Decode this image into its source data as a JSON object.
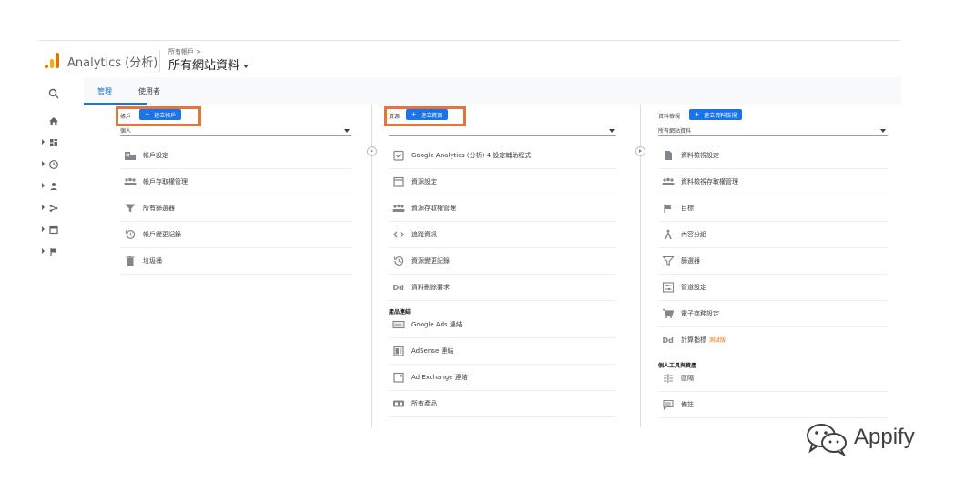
{
  "header": {
    "app_title": "Analytics (分析)",
    "breadcrumb": "所有帳戶 >",
    "view_title": "所有網站資料"
  },
  "tabs": [
    {
      "label": "管理",
      "active": true
    },
    {
      "label": "使用者",
      "active": false
    }
  ],
  "rail": {
    "icons": [
      "search-icon",
      "home-icon",
      "dashboard-icon",
      "clock-icon",
      "person-icon",
      "acquisition-icon",
      "behavior-icon",
      "flag-icon"
    ]
  },
  "account": {
    "label": "帳戶",
    "create_label": "建立帳戶",
    "selected": "個人",
    "items": [
      {
        "label": "帳戶設定",
        "icon": "building-icon"
      },
      {
        "label": "帳戶存取權管理",
        "icon": "people-icon"
      },
      {
        "label": "所有篩選器",
        "icon": "filter-icon"
      },
      {
        "label": "帳戶變更記錄",
        "icon": "history-icon"
      },
      {
        "label": "垃圾桶",
        "icon": "trash-icon"
      }
    ]
  },
  "property": {
    "label": "資源",
    "create_label": "建立資源",
    "items": [
      {
        "label": "Google Analytics (分析) 4 設定輔助程式",
        "icon": "checklist-icon"
      },
      {
        "label": "資源設定",
        "icon": "window-icon"
      },
      {
        "label": "資源存取權管理",
        "icon": "people-icon"
      },
      {
        "label": "追蹤資訊",
        "icon": "code-icon"
      },
      {
        "label": "資源變更記錄",
        "icon": "history-icon"
      },
      {
        "label": "資料刪除要求",
        "icon": "dd-icon"
      }
    ],
    "section_title": "產品連結",
    "section_items": [
      {
        "label": "Google Ads 連結",
        "icon": "ads-icon"
      },
      {
        "label": "AdSense 連結",
        "icon": "adsense-icon"
      },
      {
        "label": "Ad Exchange 連結",
        "icon": "adexchange-icon"
      },
      {
        "label": "所有產品",
        "icon": "products-icon"
      }
    ]
  },
  "view": {
    "label": "資料檢視",
    "create_label": "建立資料檢視",
    "selected": "所有網站資料",
    "items": [
      {
        "label": "資料檢視設定",
        "icon": "document-icon"
      },
      {
        "label": "資料檢視存取權管理",
        "icon": "people-icon"
      },
      {
        "label": "目標",
        "icon": "flag-icon"
      },
      {
        "label": "內容分組",
        "icon": "person-walk-icon"
      },
      {
        "label": "篩選器",
        "icon": "filter-icon"
      },
      {
        "label": "管道設定",
        "icon": "channel-icon"
      },
      {
        "label": "電子商務設定",
        "icon": "cart-icon"
      },
      {
        "label": "計算指標",
        "icon": "dd-icon",
        "badge": "測試版"
      }
    ],
    "section_title": "個人工具與資產",
    "section_items": [
      {
        "label": "區隔",
        "icon": "segments-icon"
      },
      {
        "label": "備註",
        "icon": "comment-icon"
      }
    ]
  },
  "watermark": {
    "text": "Appify"
  },
  "colors": {
    "accent": "#1a73e8",
    "highlight": "#e0763c",
    "logo_orange": "#e37400",
    "logo_yellow": "#f9ab00"
  }
}
